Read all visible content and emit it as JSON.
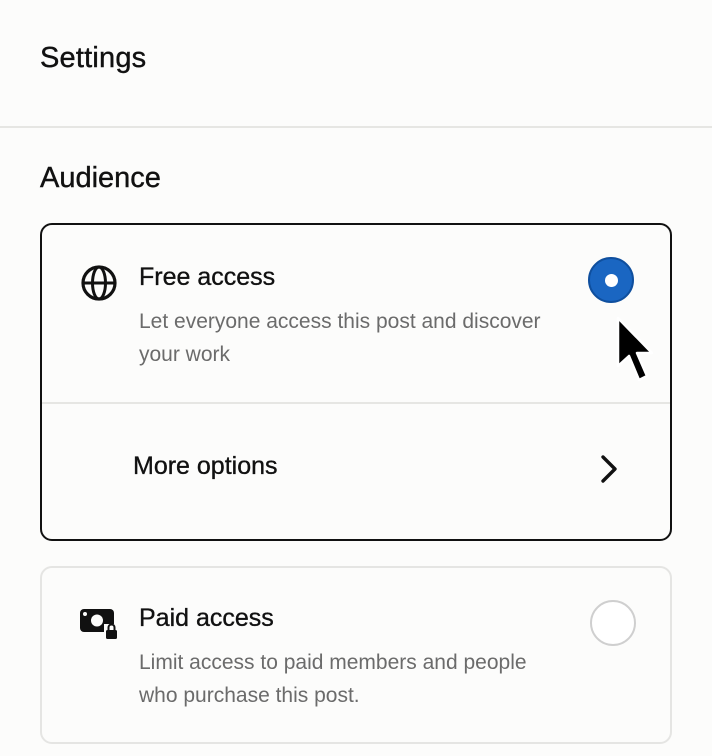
{
  "header": {
    "title": "Settings"
  },
  "audience": {
    "section_title": "Audience",
    "accent_color": "#1a66c2",
    "options": [
      {
        "title": "Free access",
        "description": "Let everyone access this post and discover your work",
        "icon": "globe-icon",
        "selected": true,
        "more_options_label": "More options"
      },
      {
        "title": "Paid access",
        "description": "Limit access to paid members and people who purchase this post.",
        "icon": "money-lock-icon",
        "selected": false
      }
    ]
  }
}
